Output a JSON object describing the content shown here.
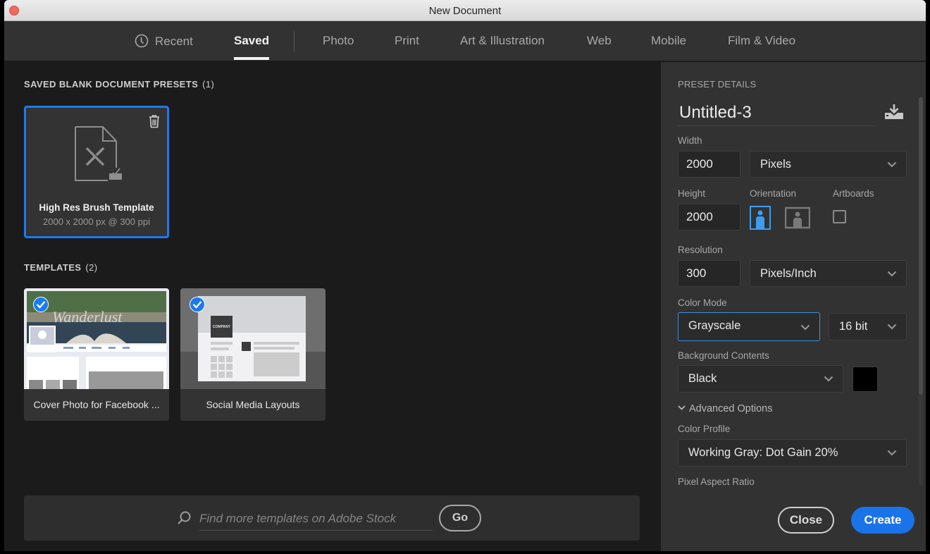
{
  "window": {
    "title": "New Document"
  },
  "tabs": [
    {
      "label": "Recent",
      "icon": "clock-icon",
      "active": false
    },
    {
      "label": "Saved",
      "active": true
    },
    {
      "label": "Photo",
      "active": false
    },
    {
      "label": "Print",
      "active": false
    },
    {
      "label": "Art & Illustration",
      "active": false
    },
    {
      "label": "Web",
      "active": false
    },
    {
      "label": "Mobile",
      "active": false
    },
    {
      "label": "Film & Video",
      "active": false
    }
  ],
  "saved_presets": {
    "title": "SAVED BLANK DOCUMENT PRESETS",
    "count": "(1)",
    "items": [
      {
        "name": "High Res Brush Template",
        "meta": "2000 x 2000 px @ 300 ppi",
        "selected": true
      }
    ]
  },
  "templates": {
    "title": "TEMPLATES",
    "count": "(2)",
    "items": [
      {
        "name": "Cover Photo for Facebook ...",
        "thumb_text": "Wanderlust",
        "licensed": true
      },
      {
        "name": "Social Media Layouts",
        "thumb_text": "COMPANY",
        "licensed": true
      }
    ]
  },
  "stock_search": {
    "placeholder": "Find more templates on Adobe Stock",
    "value": "",
    "go_label": "Go"
  },
  "preset_details": {
    "heading": "PRESET DETAILS",
    "document_name": "Untitled-3",
    "width_label": "Width",
    "width_value": "2000",
    "width_unit": "Pixels",
    "height_label": "Height",
    "height_value": "2000",
    "orientation_label": "Orientation",
    "orientation": "portrait",
    "artboards_label": "Artboards",
    "artboards_checked": false,
    "resolution_label": "Resolution",
    "resolution_value": "300",
    "resolution_unit": "Pixels/Inch",
    "color_mode_label": "Color Mode",
    "color_mode": "Grayscale",
    "bit_depth": "16 bit",
    "background_label": "Background Contents",
    "background": "Black",
    "background_color": "#000000",
    "advanced_label": "Advanced Options",
    "color_profile_label": "Color Profile",
    "color_profile": "Working Gray: Dot Gain 20%",
    "pixel_aspect_label": "Pixel Aspect Ratio"
  },
  "actions": {
    "close_label": "Close",
    "create_label": "Create"
  },
  "colors": {
    "accent": "#1a73e8",
    "selection": "#1a7af0",
    "panel": "#323232",
    "background": "#1b1b1b"
  }
}
